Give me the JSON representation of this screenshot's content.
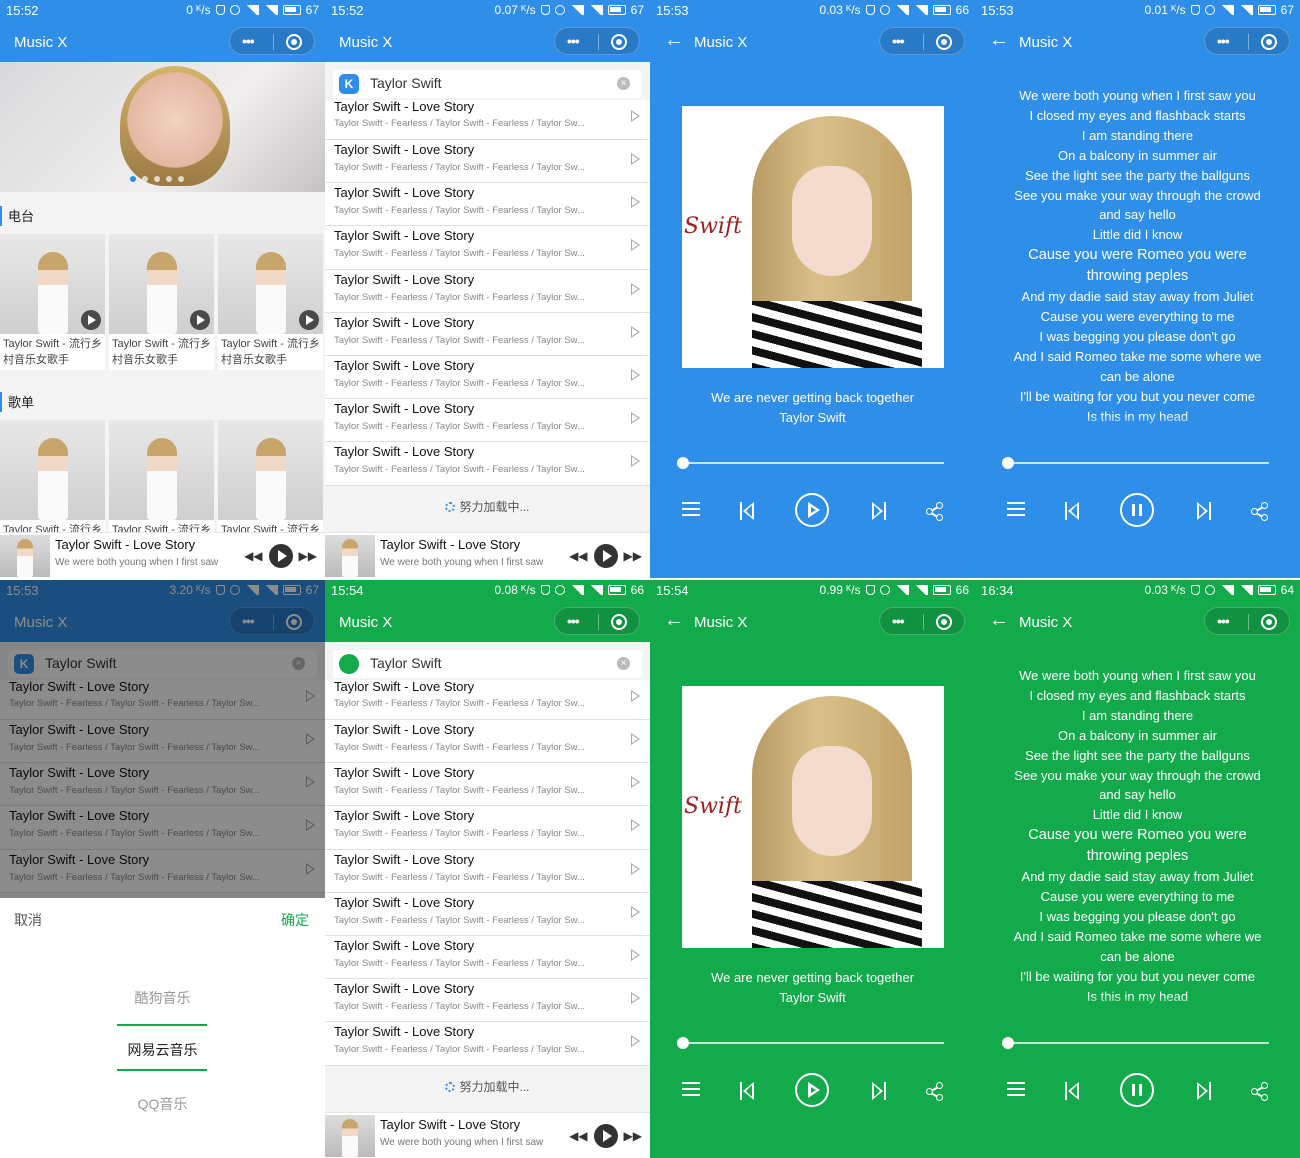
{
  "app_title": "Music X",
  "colors": {
    "blue": "#2f8ee8",
    "green": "#13aa4b"
  },
  "screens": [
    {
      "status": {
        "time": "15:52",
        "speed": "0 ᴷ/s",
        "battery": "67"
      }
    },
    {
      "status": {
        "time": "15:52",
        "speed": "0.07 ᴷ/s",
        "battery": "67"
      }
    },
    {
      "status": {
        "time": "15:53",
        "speed": "0.03 ᴷ/s",
        "battery": "66"
      }
    },
    {
      "status": {
        "time": "15:53",
        "speed": "0.01 ᴷ/s",
        "battery": "67"
      }
    },
    {
      "status": {
        "time": "15:53",
        "speed": "3.20 ᴷ/s",
        "battery": "67"
      }
    },
    {
      "status": {
        "time": "15:54",
        "speed": "0.08 ᴷ/s",
        "battery": "66"
      }
    },
    {
      "status": {
        "time": "15:54",
        "speed": "0.99 ᴷ/s",
        "battery": "66"
      }
    },
    {
      "status": {
        "time": "16:34",
        "speed": "0.03 ᴷ/s",
        "battery": "64"
      }
    }
  ],
  "home": {
    "section_radio": "电台",
    "section_playlist": "歌单",
    "card_caption_line1": "Taylor Swift - 流行乡",
    "card_caption_line2": "村音乐女歌手",
    "playlist_caption": "Taylor Swift - 流行乡"
  },
  "search": {
    "query": "Taylor Swift",
    "kugou_logo": "K",
    "loading": "努力加载中..."
  },
  "result": {
    "title": "Taylor Swift - Love Story",
    "subtitle": "Taylor Swift - Fearless / Taylor Swift - Fearless / Taylor Sw..."
  },
  "mini_player": {
    "title": "Taylor Swift - Love Story",
    "subtitle": "We were both young when I first saw ..."
  },
  "now_playing": {
    "song": "We are never getting back together",
    "artist": "Taylor Swift",
    "cover_signature": "Swift",
    "progress": 0.0
  },
  "lyrics": [
    {
      "text": "We were both young when I first saw you",
      "big": false
    },
    {
      "text": "I closed my eyes and flashback starts",
      "big": false
    },
    {
      "text": "I am standing there",
      "big": false
    },
    {
      "text": "On a balcony in summer air",
      "big": false
    },
    {
      "text": "See the light see the party the ballguns",
      "big": false
    },
    {
      "text": "See you make your way through the crowd",
      "big": false
    },
    {
      "text": "and say hello",
      "big": false
    },
    {
      "text": "Little did I know",
      "big": false
    },
    {
      "text": "Cause you were Romeo you were",
      "big": true
    },
    {
      "text": "throwing peples",
      "big": true
    },
    {
      "text": "And my dadie said stay away from Juliet",
      "big": false
    },
    {
      "text": "Cause you were everything to me",
      "big": false
    },
    {
      "text": "I was begging you please don't go",
      "big": false
    },
    {
      "text": "And I said Romeo take me some where we",
      "big": false
    },
    {
      "text": "can be alone",
      "big": false
    },
    {
      "text": "I'll be waiting for you but you never come",
      "big": false
    },
    {
      "text": "Is this in my head",
      "big": false
    }
  ],
  "picker": {
    "cancel": "取消",
    "confirm": "确定",
    "options": [
      "酷狗音乐",
      "网易云音乐",
      "QQ音乐"
    ],
    "selected": 1
  }
}
